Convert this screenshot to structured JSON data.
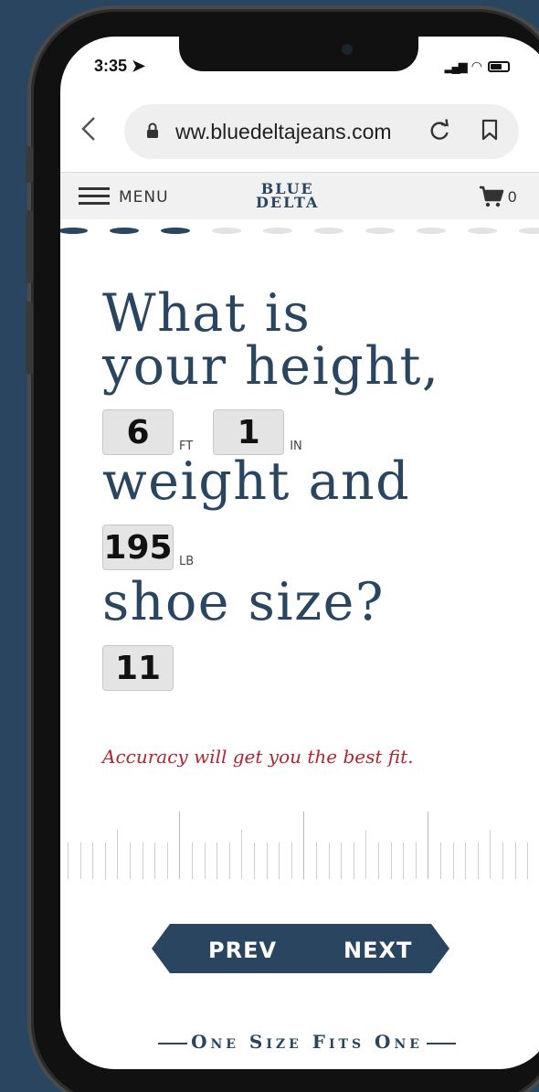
{
  "status_bar": {
    "time": "3:35",
    "location_icon": "location-arrow-icon",
    "signal_icon": "signal-icon",
    "wifi_icon": "wifi-icon",
    "battery_icon": "battery-icon"
  },
  "browser": {
    "url": "ww.bluedeltajeans.com",
    "back_icon": "chevron-left-icon",
    "lock_icon": "lock-icon",
    "reload_icon": "reload-icon",
    "bookmark_icon": "bookmark-icon"
  },
  "site_header": {
    "menu_label": "MENU",
    "logo_line1": "BLUE",
    "logo_line2": "DELTA",
    "cart_count": "0"
  },
  "progress": {
    "total_steps": 10,
    "completed_steps": 3,
    "active_color": "#2a4560",
    "inactive_color": "#e3e3e3"
  },
  "question": {
    "line1": "What is",
    "line2": "your height,",
    "line3": "weight and",
    "line4": "shoe size?",
    "height_ft": "6",
    "height_ft_unit": "FT",
    "height_in": "1",
    "height_in_unit": "IN",
    "weight": "195",
    "weight_unit": "LB",
    "shoe_size": "11"
  },
  "hint": "Accuracy will get you the best fit.",
  "nav": {
    "prev_label": "PREV",
    "next_label": "NEXT"
  },
  "tagline": "One Size Fits One",
  "colors": {
    "navy": "#2a4560",
    "hint_red": "#b22430",
    "field_bg": "#e4e4e4"
  }
}
